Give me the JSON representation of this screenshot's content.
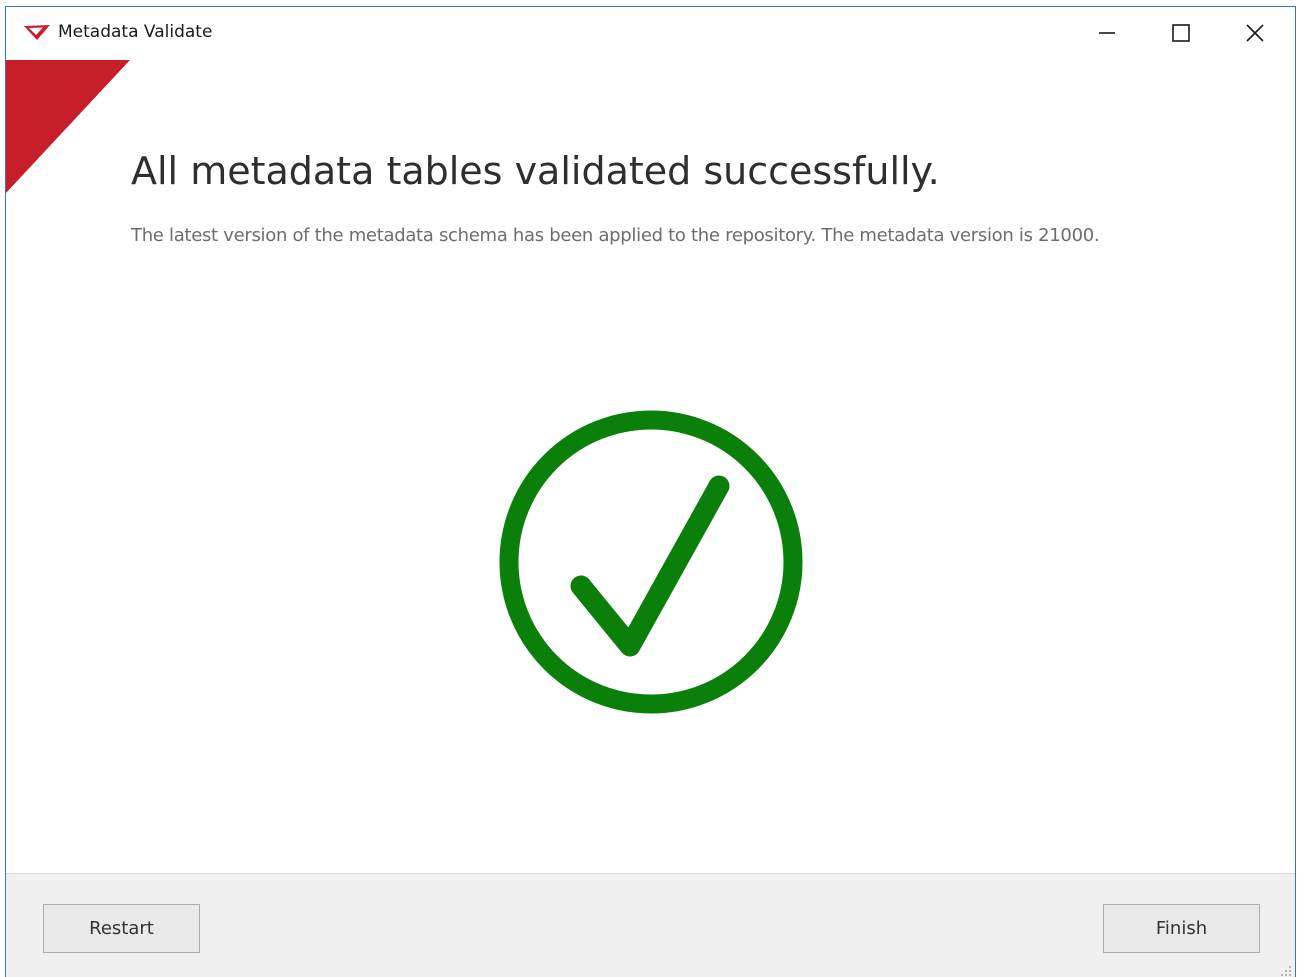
{
  "window": {
    "title": "Metadata Validate",
    "controls": {
      "minimize": "minimize-icon",
      "maximize": "maximize-icon",
      "close": "close-icon"
    }
  },
  "main": {
    "heading": "All metadata tables validated successfully.",
    "message": "The latest version of the metadata schema has been applied to the repository. The metadata version is 21000.",
    "status_icon": "check-circle-icon"
  },
  "footer": {
    "restart_label": "Restart",
    "finish_label": "Finish"
  },
  "colors": {
    "accent_red": "#c71f2a",
    "success_green": "#0a7f0a",
    "window_border": "#2b78c6",
    "footer_bg": "#f0f0f0"
  }
}
